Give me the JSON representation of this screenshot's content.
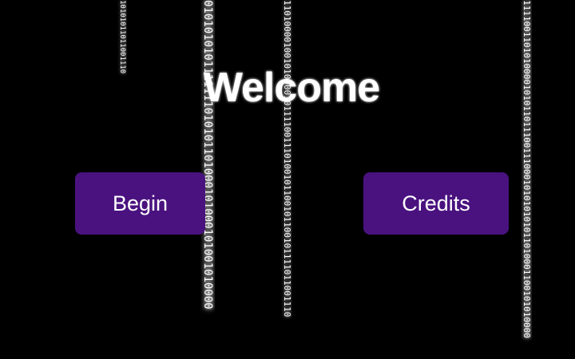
{
  "screen": {
    "title": "Welcome",
    "buttons": {
      "begin_label": "Begin",
      "credits_label": "Credits"
    }
  },
  "binary_rain": [
    "10101011011001110",
    "0101010101111111010101101000101000101001010000",
    "110100001001010000101111001110100101100101100101111011001110",
    "1111001101010000101011011100111000101010101011010001100101010000"
  ],
  "colors": {
    "background": "#000000",
    "button": "#4a127f",
    "text": "#ffffff"
  }
}
